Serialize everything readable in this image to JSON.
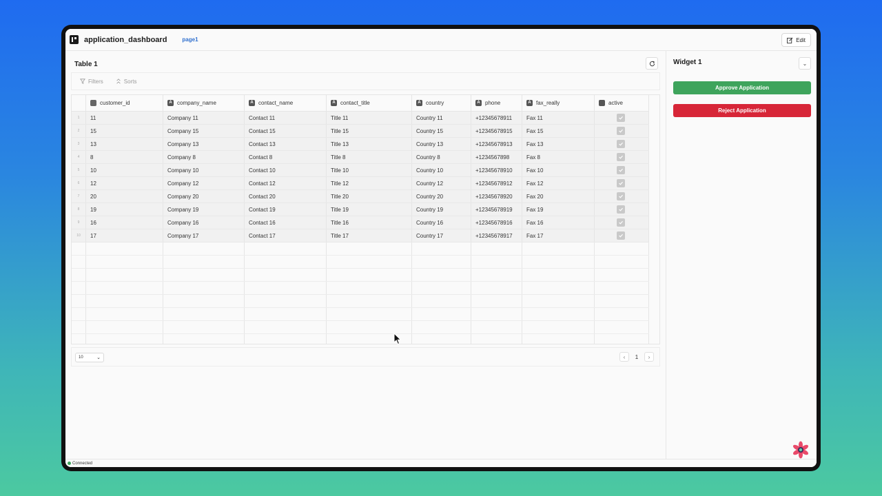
{
  "app": {
    "title": "application_dashboard",
    "page_tab": "page1",
    "edit_label": "Edit"
  },
  "table": {
    "title": "Table 1",
    "toolbar": {
      "filters_label": "Filters",
      "sorts_label": "Sorts"
    },
    "columns": [
      {
        "key": "customer_id",
        "label": "customer_id",
        "type_icon": "123"
      },
      {
        "key": "company_name",
        "label": "company_name",
        "type_icon": "A"
      },
      {
        "key": "contact_name",
        "label": "contact_name",
        "type_icon": "A"
      },
      {
        "key": "contact_title",
        "label": "contact_title",
        "type_icon": "A"
      },
      {
        "key": "country",
        "label": "country",
        "type_icon": "A"
      },
      {
        "key": "phone",
        "label": "phone",
        "type_icon": "A"
      },
      {
        "key": "fax_really",
        "label": "fax_really",
        "type_icon": "A"
      },
      {
        "key": "active",
        "label": "active",
        "type_icon": "toggle"
      }
    ],
    "rows": [
      {
        "index": "1",
        "customer_id": "11",
        "company_name": "Company 11",
        "contact_name": "Contact 11",
        "contact_title": "Title 11",
        "country": "Country 11",
        "phone": "+12345678911",
        "fax_really": "Fax 11",
        "active": true
      },
      {
        "index": "2",
        "customer_id": "15",
        "company_name": "Company 15",
        "contact_name": "Contact 15",
        "contact_title": "Title 15",
        "country": "Country 15",
        "phone": "+12345678915",
        "fax_really": "Fax 15",
        "active": true
      },
      {
        "index": "3",
        "customer_id": "13",
        "company_name": "Company 13",
        "contact_name": "Contact 13",
        "contact_title": "Title 13",
        "country": "Country 13",
        "phone": "+12345678913",
        "fax_really": "Fax 13",
        "active": true
      },
      {
        "index": "4",
        "customer_id": "8",
        "company_name": "Company 8",
        "contact_name": "Contact 8",
        "contact_title": "Title 8",
        "country": "Country 8",
        "phone": "+1234567898",
        "fax_really": "Fax 8",
        "active": true
      },
      {
        "index": "5",
        "customer_id": "10",
        "company_name": "Company 10",
        "contact_name": "Contact 10",
        "contact_title": "Title 10",
        "country": "Country 10",
        "phone": "+12345678910",
        "fax_really": "Fax 10",
        "active": true
      },
      {
        "index": "6",
        "customer_id": "12",
        "company_name": "Company 12",
        "contact_name": "Contact 12",
        "contact_title": "Title 12",
        "country": "Country 12",
        "phone": "+12345678912",
        "fax_really": "Fax 12",
        "active": true
      },
      {
        "index": "7",
        "customer_id": "20",
        "company_name": "Company 20",
        "contact_name": "Contact 20",
        "contact_title": "Title 20",
        "country": "Country 20",
        "phone": "+12345678920",
        "fax_really": "Fax 20",
        "active": true
      },
      {
        "index": "8",
        "customer_id": "19",
        "company_name": "Company 19",
        "contact_name": "Contact 19",
        "contact_title": "Title 19",
        "country": "Country 19",
        "phone": "+12345678919",
        "fax_really": "Fax 19",
        "active": true
      },
      {
        "index": "9",
        "customer_id": "16",
        "company_name": "Company 16",
        "contact_name": "Contact 16",
        "contact_title": "Title 16",
        "country": "Country 16",
        "phone": "+12345678916",
        "fax_really": "Fax 16",
        "active": true
      },
      {
        "index": "10",
        "customer_id": "17",
        "company_name": "Company 17",
        "contact_name": "Contact 17",
        "contact_title": "Title 17",
        "country": "Country 17",
        "phone": "+12345678917",
        "fax_really": "Fax 17",
        "active": true
      }
    ],
    "footer": {
      "page_size": "10",
      "current_page": "1"
    }
  },
  "widget": {
    "title": "Widget 1",
    "approve_label": "Approve Application",
    "reject_label": "Reject Application"
  },
  "status": {
    "text": "Connected"
  },
  "colors": {
    "approve": "#3ea45c",
    "reject": "#d72638",
    "link": "#2f6fce",
    "connected": "#3ea45c"
  }
}
